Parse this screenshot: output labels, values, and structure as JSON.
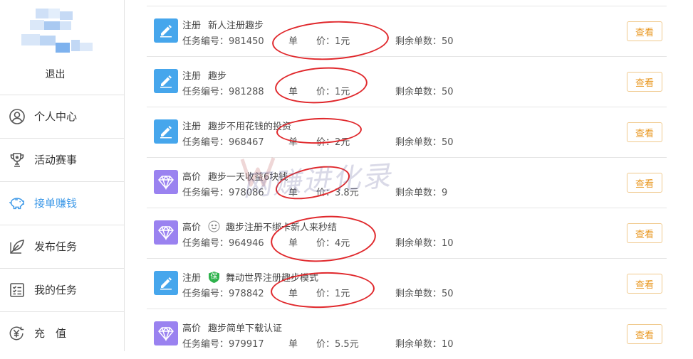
{
  "sidebar": {
    "logout_label": "退出",
    "items": [
      {
        "label": "个人中心",
        "icon": "user-icon",
        "active": false
      },
      {
        "label": "活动赛事",
        "icon": "trophy-icon",
        "active": false
      },
      {
        "label": "接单赚钱",
        "icon": "piggy-bank-icon",
        "active": true
      },
      {
        "label": "发布任务",
        "icon": "feather-icon",
        "active": false
      },
      {
        "label": "我的任务",
        "icon": "task-list-icon",
        "active": false
      },
      {
        "label": "充　值",
        "icon": "yen-coin-icon",
        "active": false
      }
    ]
  },
  "tasks": [
    {
      "category": "注册",
      "title": "新人注册趣步",
      "number_label": "任务编号：",
      "number": "981450",
      "price_label": "单　　价：",
      "price": "1元",
      "remain_label": "剩余单数：",
      "remain": "50",
      "icon": "pen-icon",
      "badge": null,
      "action": "查看"
    },
    {
      "category": "注册",
      "title": "趣步",
      "number_label": "任务编号：",
      "number": "981288",
      "price_label": "单　　价：",
      "price": "1元",
      "remain_label": "剩余单数：",
      "remain": "50",
      "icon": "pen-icon",
      "badge": null,
      "action": "查看"
    },
    {
      "category": "注册",
      "title": "趣步不用花钱的投资",
      "number_label": "任务编号：",
      "number": "968467",
      "price_label": "单　　价：",
      "price": "2元",
      "remain_label": "剩余单数：",
      "remain": "50",
      "icon": "pen-icon",
      "badge": null,
      "action": "查看"
    },
    {
      "category": "高价",
      "title": "趣步一天收益6块钱",
      "number_label": "任务编号：",
      "number": "978086",
      "price_label": "单　　价：",
      "price": "3.8元",
      "remain_label": "剩余单数：",
      "remain": "9",
      "icon": "diamond-icon",
      "badge": null,
      "action": "查看"
    },
    {
      "category": "高价",
      "title": "趣步注册不绑卡新人来秒结",
      "number_label": "任务编号：",
      "number": "964946",
      "price_label": "单　　价：",
      "price": "4元",
      "remain_label": "剩余单数：",
      "remain": "10",
      "icon": "diamond-icon",
      "badge": "smiley-icon",
      "action": "查看"
    },
    {
      "category": "注册",
      "title": "舞动世界注册趣步模式",
      "number_label": "任务编号：",
      "number": "978842",
      "price_label": "单　　价：",
      "price": "1元",
      "remain_label": "剩余单数：",
      "remain": "50",
      "icon": "pen-icon",
      "badge": "shield-guarantee-icon",
      "badge_text": "保",
      "action": "查看"
    },
    {
      "category": "高价",
      "title": "趣步简单下载认证",
      "number_label": "任务编号：",
      "number": "979917",
      "price_label": "单　　价：",
      "price": "5.5元",
      "remain_label": "剩余单数：",
      "remain": "10",
      "icon": "diamond-icon",
      "badge": null,
      "action": "查看"
    }
  ],
  "watermark": {
    "text": "网赚进化录"
  },
  "colors": {
    "accent": "#3f9ae8",
    "button_text": "#e8961e",
    "button_border": "#f0c98c",
    "annotation": "#e0282c",
    "pen_icon_bg": "#46a6ec",
    "diamond_icon_bg": "#9a82f0"
  }
}
